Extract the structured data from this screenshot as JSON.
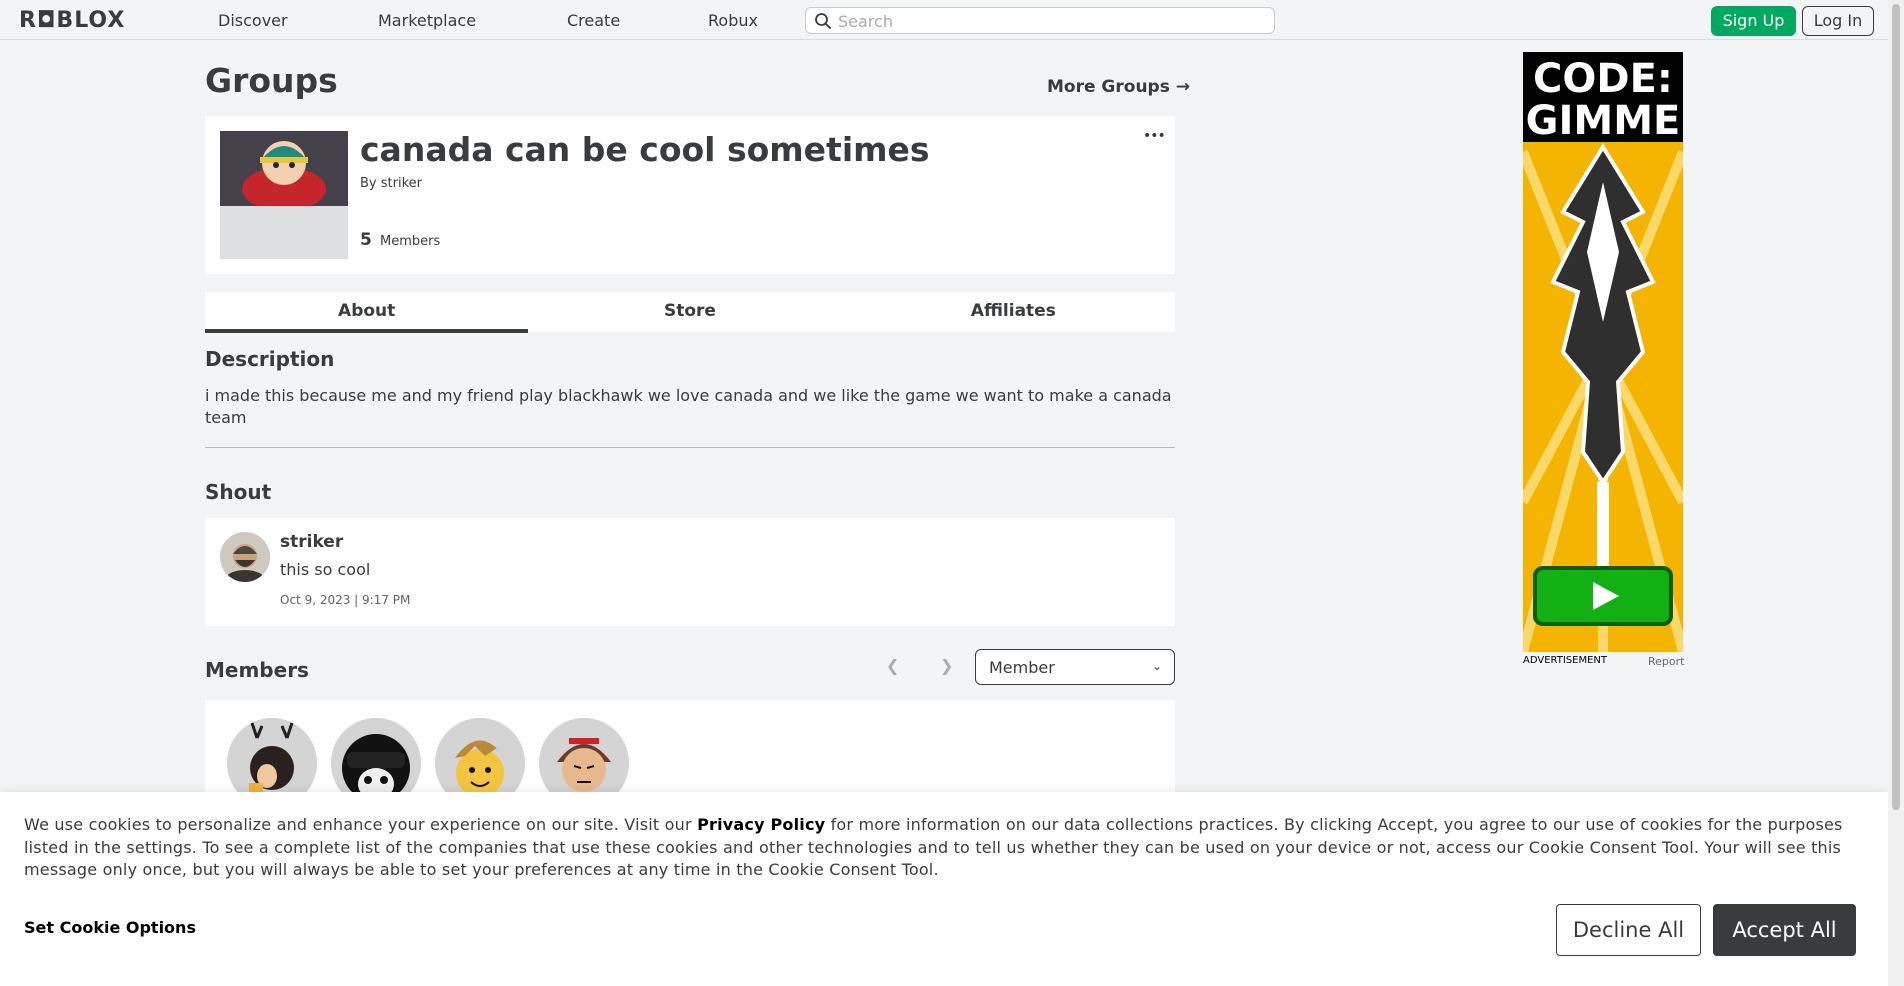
{
  "nav": {
    "logo": "R◘BLOX",
    "links": [
      "Discover",
      "Marketplace",
      "Create",
      "Robux"
    ],
    "search_placeholder": "Search",
    "signup_label": "Sign Up",
    "login_label": "Log In"
  },
  "page": {
    "title": "Groups",
    "more_groups": "More Groups →"
  },
  "group": {
    "name": "canada can be cool sometimes",
    "by_label": "By",
    "owner": "striker",
    "member_count": "5",
    "members_label": "Members",
    "more_options": "•••"
  },
  "tabs": [
    "About",
    "Store",
    "Affiliates"
  ],
  "description": {
    "heading": "Description",
    "text": "i made this because me and my friend play blackhawk we love canada and we like the game we want to make a canada team"
  },
  "shout": {
    "heading": "Shout",
    "author": "striker",
    "body": "this so cool",
    "date": "Oct 9, 2023 | 9:17 PM"
  },
  "members": {
    "heading": "Members",
    "role_selected": "Member"
  },
  "ad": {
    "headline_line1": "CODE:",
    "headline_line2": "GIMME",
    "label": "ADVERTISEMENT",
    "report": "Report"
  },
  "cookie": {
    "text_before": "We use cookies to personalize and enhance your experience on our site. Visit our ",
    "privacy_link": "Privacy Policy",
    "text_after": " for more information on our data collections practices. By clicking Accept, you agree to our use of cookies for the purposes listed in the settings. To see a complete list of the companies that use these cookies and other technologies and to tell us whether they can be used on your device or not, access our Cookie Consent Tool. Your will see this message only once, but you will always be able to set your preferences at any time in the Cookie Consent Tool.",
    "options_label": "Set Cookie Options",
    "decline_label": "Decline All",
    "accept_label": "Accept All"
  },
  "colors": {
    "accent_green": "#00a860",
    "text_dark": "#393b3d",
    "background": "#f2f4f5"
  }
}
